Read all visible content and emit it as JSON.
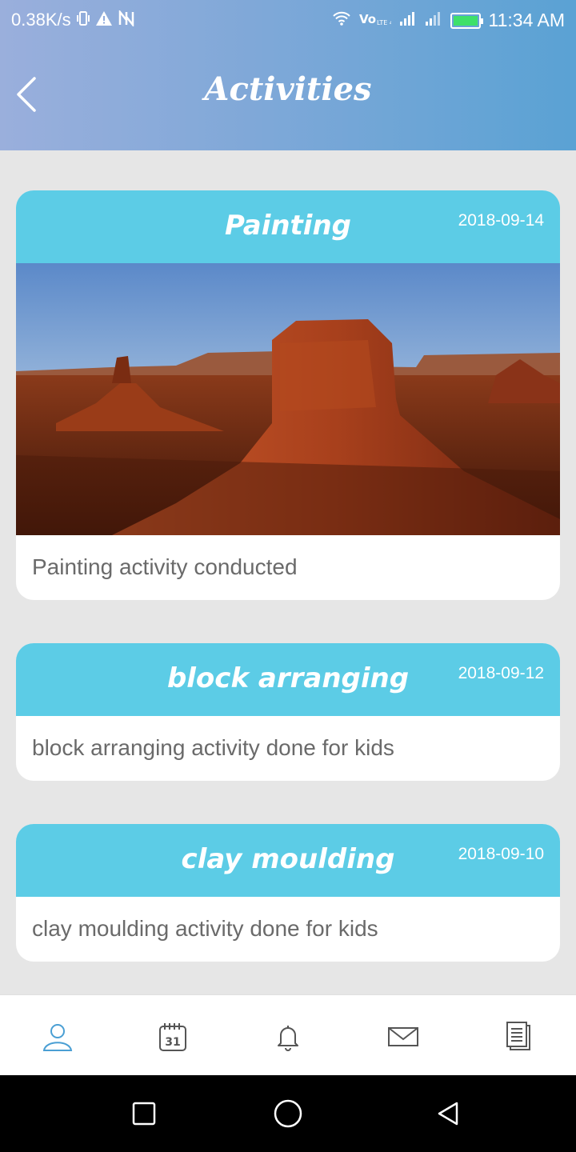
{
  "status_bar": {
    "speed": "0.38K/s",
    "time": "11:34 AM",
    "icons": [
      "vibrate-icon",
      "warning-icon",
      "nfc-icon",
      "wifi-icon",
      "volte-icon",
      "signal-icon",
      "signal-icon",
      "battery-icon"
    ]
  },
  "header": {
    "title": "Activities",
    "back_icon": "chevron-left-icon"
  },
  "activities": [
    {
      "title": "Painting",
      "date": "2018-09-14",
      "description": "Painting activity conducted",
      "has_image": true
    },
    {
      "title": "block arranging",
      "date": "2018-09-12",
      "description": "block arranging activity done for kids",
      "has_image": false
    },
    {
      "title": "clay moulding",
      "date": "2018-09-10",
      "description": "clay moulding activity done for kids",
      "has_image": false
    }
  ],
  "bottom_nav": {
    "items": [
      "profile-icon",
      "calendar-icon",
      "bell-icon",
      "mail-icon",
      "documents-icon"
    ],
    "calendar_day": "31"
  },
  "colors": {
    "card_header": "#5ccce6",
    "active_nav": "#4a9fd4",
    "header_gradient_start": "#9aafdc",
    "header_gradient_end": "#5aa2d4"
  }
}
